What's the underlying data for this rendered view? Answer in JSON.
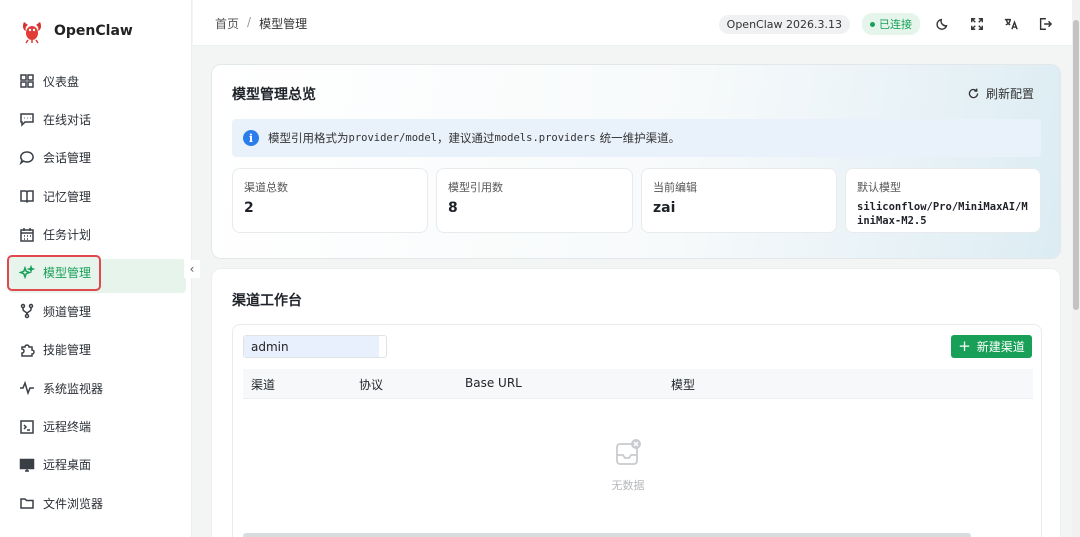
{
  "brand": {
    "name": "OpenClaw"
  },
  "sidebar": {
    "items": [
      {
        "label": "仪表盘",
        "icon": "dashboard-icon"
      },
      {
        "label": "在线对话",
        "icon": "chat-icon"
      },
      {
        "label": "会话管理",
        "icon": "session-icon"
      },
      {
        "label": "记忆管理",
        "icon": "book-icon"
      },
      {
        "label": "任务计划",
        "icon": "calendar-icon"
      },
      {
        "label": "模型管理",
        "icon": "sparkle-icon",
        "active": true
      },
      {
        "label": "频道管理",
        "icon": "branch-icon"
      },
      {
        "label": "技能管理",
        "icon": "puzzle-icon"
      },
      {
        "label": "系统监视器",
        "icon": "pulse-icon"
      },
      {
        "label": "远程终端",
        "icon": "terminal-icon"
      },
      {
        "label": "远程桌面",
        "icon": "monitor-icon"
      },
      {
        "label": "文件浏览器",
        "icon": "folder-icon"
      }
    ]
  },
  "header": {
    "breadcrumb": [
      "首页",
      "模型管理"
    ],
    "version": "OpenClaw 2026.3.13",
    "status": "已连接",
    "colors": {
      "accent": "#18a058",
      "info": "#2b7de9"
    }
  },
  "overview": {
    "title": "模型管理总览",
    "refresh_label": "刷新配置",
    "info": {
      "prefix": "模型引用格式为",
      "code1": "provider/model",
      "middle": "，建议通过",
      "code2": "models.providers",
      "suffix": "统一维护渠道。"
    },
    "stats": [
      {
        "label": "渠道总数",
        "value": "2"
      },
      {
        "label": "模型引用数",
        "value": "8"
      },
      {
        "label": "当前编辑",
        "value": "zai"
      },
      {
        "label": "默认模型",
        "value": "siliconflow/Pro/MiniMaxAI/MiniMax-M2.5"
      }
    ]
  },
  "workbench": {
    "title": "渠道工作台",
    "search_value": "admin",
    "new_button": "新建渠道",
    "columns": [
      "渠道",
      "协议",
      "Base URL",
      "模型"
    ],
    "empty_text": "无数据"
  }
}
